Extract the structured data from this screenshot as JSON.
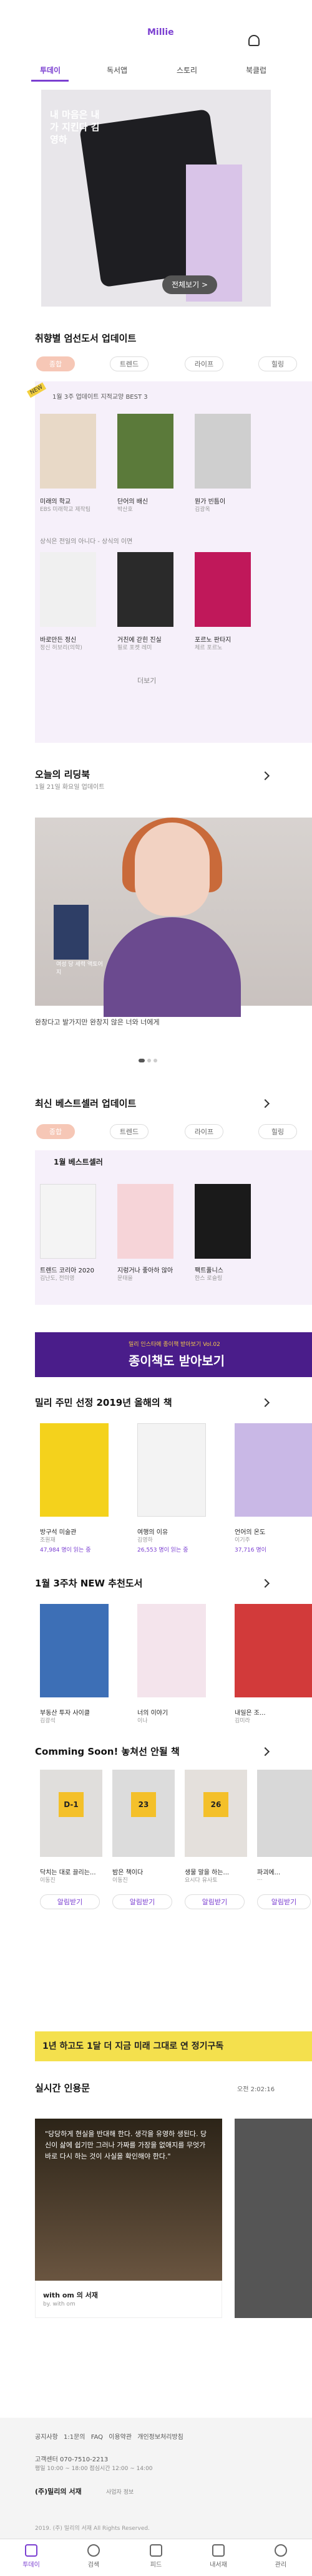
{
  "app": {
    "logo": "Millie"
  },
  "tabs": [
    "투데이",
    "독서앱",
    "스토리",
    "북클럽"
  ],
  "hero": {
    "title_lines": "내 마음은 내가 지킨다 김영하",
    "button": "전체보기 >",
    "book_title": "김영하",
    "book_sub": "말하다",
    "colors": {
      "bg": "#e8e6ea",
      "book": "#1e1e22"
    }
  },
  "s1": {
    "title": "취향별 엄선도서 업데이트",
    "chips": [
      "종합",
      "트렌드",
      "라이프",
      "힐링"
    ],
    "new_badge": "NEW",
    "sub": "1월 3주 업데이트 지적교양 BEST 3",
    "books": [
      {
        "t": "미래의 학교",
        "a": "EBS 미래학교 제작팀"
      },
      {
        "t": "단어의 배신",
        "a": "박산호"
      },
      {
        "t": "뭔가 빈틈이",
        "a": "김광옥"
      },
      {
        "t": "바로만든 정신",
        "a": "정신 허보리(의학)"
      },
      {
        "t": "거친에 갇힌 진실",
        "a": "필로 포켓 레미"
      },
      {
        "t": "포르노 판타지",
        "a": "체르 포르노"
      }
    ],
    "sub2": "상식은 전일의 아니다 - 상식의 이면",
    "more": "더보기"
  },
  "s2": {
    "title": "오늘의 리딩북",
    "sub": "1월 21일 화요일 업데이트",
    "caption": "완창다고 발가지만 완창지 않은 너와 너에게",
    "card": "여성 당 세력 액토어지"
  },
  "s3": {
    "title": "최신 베스트셀러 업데이트",
    "chips": [
      "종합",
      "트렌드",
      "라이프",
      "힐링"
    ],
    "label": "1월 베스트셀러",
    "books": [
      {
        "t": "트렌드 코리아 2020",
        "a": "김난도, 전미영"
      },
      {
        "t": "지렁거나 좋아하 않아",
        "a": "문태을"
      },
      {
        "t": "팩트풀니스",
        "a": "한스 로슬링"
      }
    ]
  },
  "banner": {
    "small": "밀리 인스타에 종이책 받아보기 Vol.02",
    "big": "종이책도 받아보기"
  },
  "s4": {
    "title": "밀리 주민 선정 2019년 올해의 책",
    "books": [
      {
        "t": "방구석 미술관",
        "a": "조원재",
        "c": "47,984 명이 읽는 중"
      },
      {
        "t": "여행의 이유",
        "a": "김영하",
        "c": "26,553 명이 읽는 중"
      },
      {
        "t": "언어의 온도",
        "a": "이기주",
        "c": "37,716 명이"
      }
    ]
  },
  "s5": {
    "title": "1월 3주차 NEW 추천도서",
    "books": [
      {
        "t": "부동산 투자 사이클",
        "a": "김광석"
      },
      {
        "t": "너의 이야기",
        "a": "이나"
      },
      {
        "t": "내일은 조...",
        "a": "김미라"
      }
    ]
  },
  "s6": {
    "title": "Comming Soon! 놓쳐선 안될 책",
    "dates": [
      "D-1",
      "23",
      "26"
    ],
    "books": [
      {
        "t": "닥치는 대로 끌리는...",
        "a": "이동진"
      },
      {
        "t": "밤은 책이다",
        "a": "이동진"
      },
      {
        "t": "생물 말을 하는...",
        "a": "요시다 유사토"
      },
      {
        "t": "파괴에...",
        "a": "..."
      }
    ],
    "btn": "알림받기"
  },
  "promo": {
    "text": "1년 하고도 1달 더 지금 미래 그대로 연 정기구독"
  },
  "s7": {
    "title": "실시간 인용문",
    "time": "오전 2:02:16",
    "quote": "\"당당하게 현실을 반대해 한다. 생각을 유영하 생된다. 당신이 삶에 쉽기만 그러나 가짜를 가장을 없애지를 무엇가 바로 다시 하는 것이 사실을 확인해야 한다.\"",
    "src": "with om 의 서재",
    "by": "by. with om"
  },
  "footer": {
    "links": [
      "공지사항",
      "1:1문의",
      "FAQ",
      "이용약관",
      "개인정보처리방침"
    ],
    "contact": "고객센터 070-7510-2213",
    "hours": "평일 10:00 ~ 18:00 점심시간 12:00 ~ 14:00",
    "company": "(주)밀리의 서재",
    "company_sub": "사업자 정보",
    "copy": "2019. (주) 밀리의 서재 All Rights Reserved."
  },
  "nav": [
    "투데이",
    "검색",
    "피드",
    "내서재",
    "관리"
  ]
}
